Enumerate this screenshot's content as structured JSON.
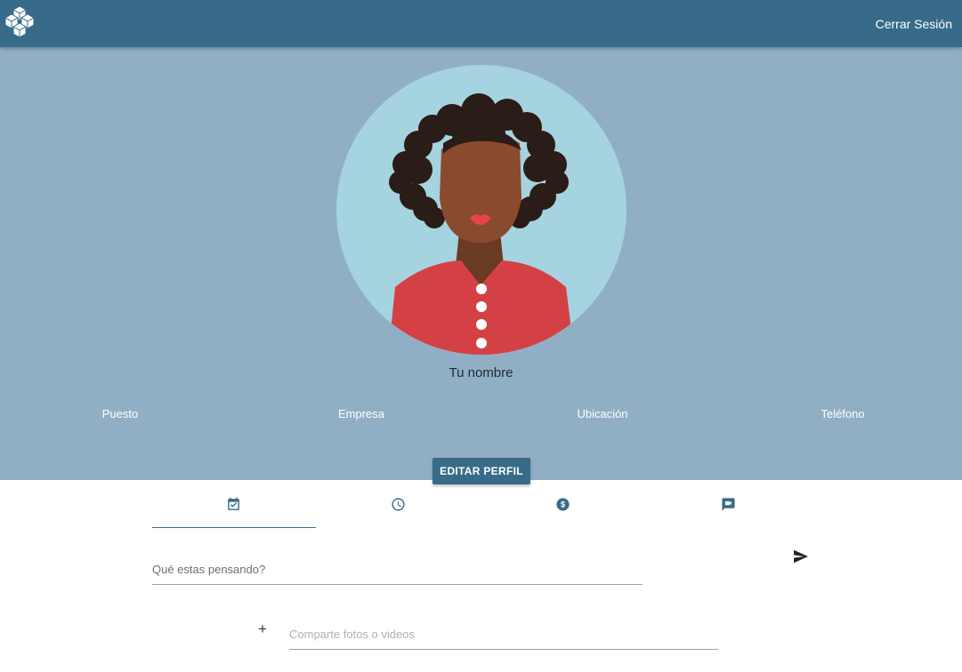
{
  "header": {
    "logo_icon": "cube-cluster-logo",
    "logout_label": "Cerrar Sesión",
    "color": "#386b89"
  },
  "profile": {
    "name": "Tu nombre",
    "fields": {
      "position": "Puesto",
      "company": "Empresa",
      "location": "Ubicación",
      "phone": "Teléfono"
    },
    "edit_label": "EDITAR PERFIL",
    "avatar_icon": "woman-avatar",
    "background": "#91afc4"
  },
  "tabs": [
    {
      "icon": "calendar-check-icon",
      "active": true
    },
    {
      "icon": "clock-icon",
      "active": false
    },
    {
      "icon": "dollar-circle-icon",
      "active": false
    },
    {
      "icon": "video-chat-icon",
      "active": false
    }
  ],
  "composer": {
    "post_placeholder": "Qué estas pensando?",
    "send_icon": "send-icon",
    "add_icon": "plus-icon",
    "add_label": "+",
    "media_placeholder": "Comparte fotos o videos"
  }
}
